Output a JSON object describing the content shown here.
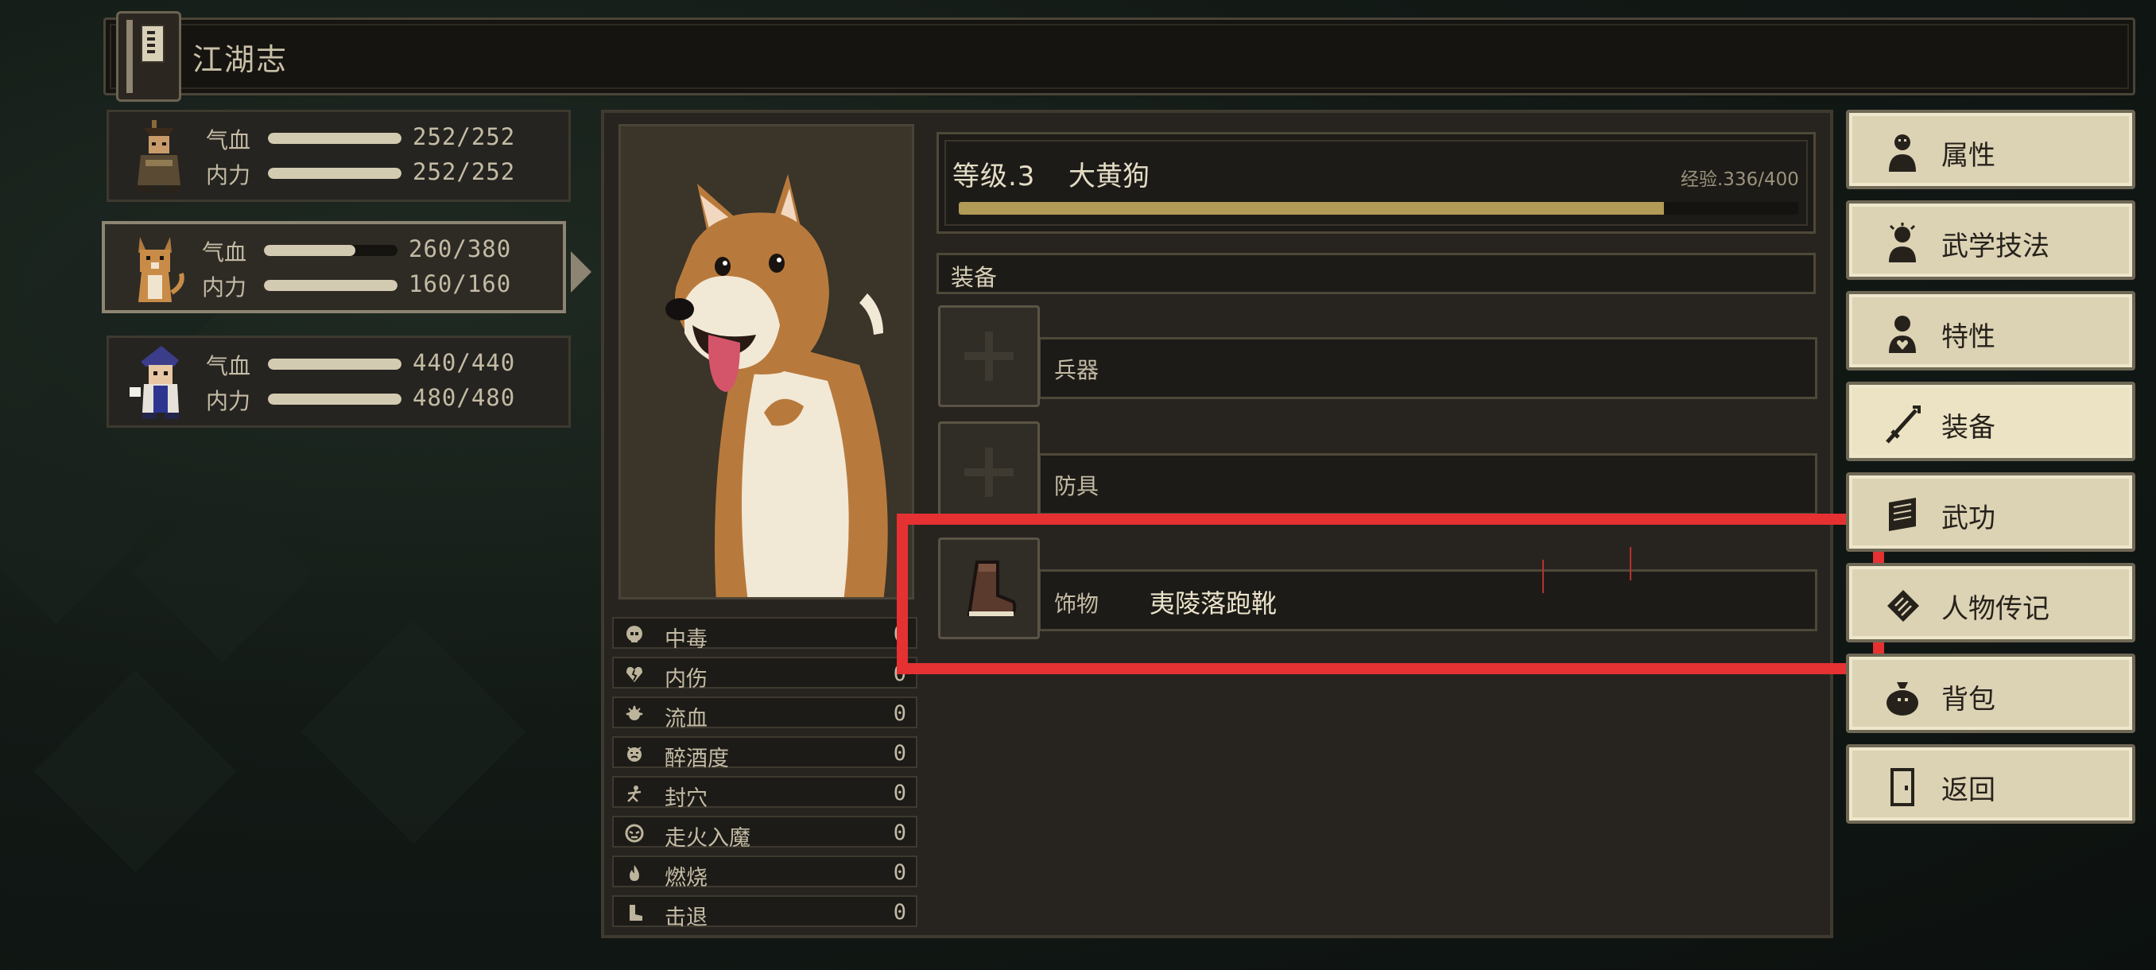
{
  "header": {
    "title": "江湖志",
    "book_icon": "book-icon"
  },
  "party": [
    {
      "name": "party-member-1",
      "hp_label": "气血",
      "hp_value": "252/252",
      "hp_fraction": 1.0,
      "mp_label": "内力",
      "mp_value": "252/252",
      "mp_fraction": 1.0
    },
    {
      "name": "party-member-2-dog",
      "hp_label": "气血",
      "hp_value": "260/380",
      "hp_fraction": 0.684,
      "mp_label": "内力",
      "mp_value": "160/160",
      "mp_fraction": 1.0
    },
    {
      "name": "party-member-3",
      "hp_label": "气血",
      "hp_value": "440/440",
      "hp_fraction": 1.0,
      "mp_label": "内力",
      "mp_value": "480/480",
      "mp_fraction": 1.0
    }
  ],
  "character": {
    "level_label": "等级.3",
    "name": "大黄狗",
    "exp_text": "经验.336/400",
    "exp_fraction": 0.84
  },
  "status_effects": [
    {
      "label": "中毒",
      "value": "0",
      "icon": "skull-icon"
    },
    {
      "label": "内伤",
      "value": "0",
      "icon": "broken-heart-icon"
    },
    {
      "label": "流血",
      "value": "0",
      "icon": "blood-icon"
    },
    {
      "label": "醉酒度",
      "value": "0",
      "icon": "drunk-face-icon"
    },
    {
      "label": "封穴",
      "value": "0",
      "icon": "acupoint-icon"
    },
    {
      "label": "走火入魔",
      "value": "0",
      "icon": "demon-face-icon"
    },
    {
      "label": "燃烧",
      "value": "0",
      "icon": "fire-icon"
    },
    {
      "label": "击退",
      "value": "0",
      "icon": "knockback-boot-icon"
    }
  ],
  "equipment": {
    "title": "装备",
    "slots": [
      {
        "label": "兵器",
        "item": ""
      },
      {
        "label": "防具",
        "item": ""
      },
      {
        "label": "饰物",
        "item": "夷陵落跑靴"
      }
    ]
  },
  "menu": [
    {
      "label": "属性",
      "icon": "person-icon",
      "active": false
    },
    {
      "label": "武学技法",
      "icon": "martial-person-icon",
      "active": false
    },
    {
      "label": "特性",
      "icon": "trait-person-icon",
      "active": false
    },
    {
      "label": "装备",
      "icon": "sword-icon",
      "active": true
    },
    {
      "label": "武功",
      "icon": "scroll-icon",
      "active": false
    },
    {
      "label": "人物传记",
      "icon": "biography-icon",
      "active": false
    },
    {
      "label": "背包",
      "icon": "bag-icon",
      "active": false
    },
    {
      "label": "返回",
      "icon": "door-icon",
      "active": false
    }
  ],
  "colors": {
    "highlight": "#e53132",
    "exp_bar": "#b29a57",
    "menu_bg": "#dcd2b4"
  }
}
